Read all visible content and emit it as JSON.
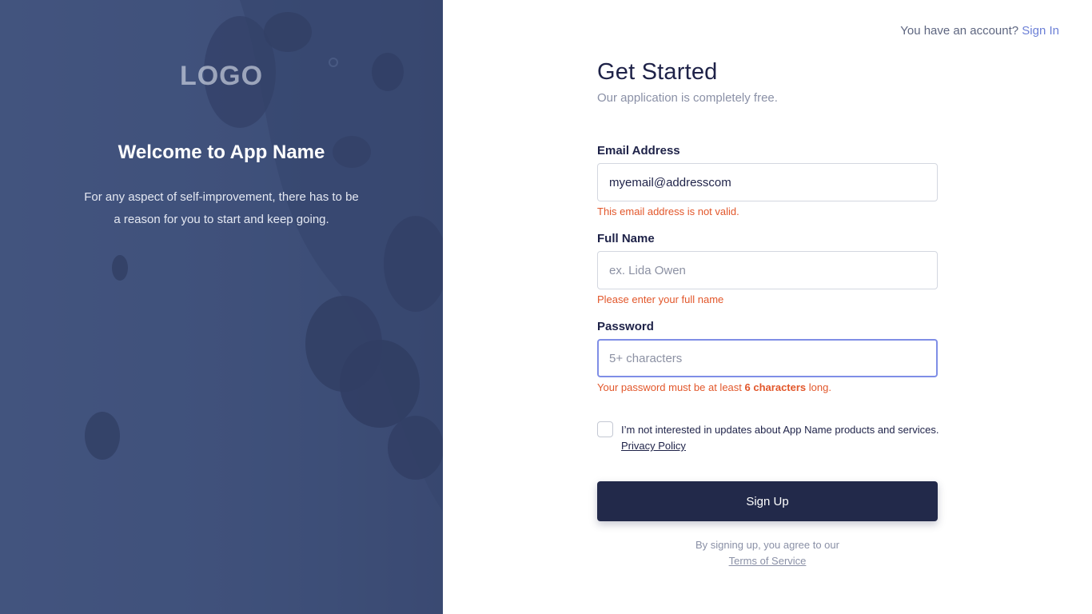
{
  "left_panel": {
    "logo": "LOGO",
    "welcome": "Welcome to App Name",
    "tagline": "For any aspect of self-improvement, there has to be a reason for you to start and keep going."
  },
  "header": {
    "account_prompt": "You have an account?",
    "sign_in_label": "Sign In"
  },
  "form": {
    "title": "Get Started",
    "subtitle": "Our application is completely free.",
    "email": {
      "label": "Email Address",
      "value": "myemail@addresscom",
      "error": "This email address is not valid."
    },
    "full_name": {
      "label": "Full Name",
      "placeholder": "ex. Lida Owen",
      "error": "Please enter your full name"
    },
    "password": {
      "label": "Password",
      "placeholder": "5+ characters",
      "error_prefix": "Your password must be at least",
      "error_bold": "6 characters",
      "error_suffix": "long."
    },
    "opt_out": {
      "text": "I’m not interested in updates about App Name products and services.",
      "privacy_link": "Privacy Policy",
      "checked": false
    },
    "submit_label": "Sign Up",
    "legal_text": "By signing up, you agree to our",
    "terms_link": "Terms of Service"
  },
  "colors": {
    "primary_dark": "#22294a",
    "error": "#e2572b",
    "link": "#6b7fd6",
    "focus_border": "#7f8ee6"
  }
}
